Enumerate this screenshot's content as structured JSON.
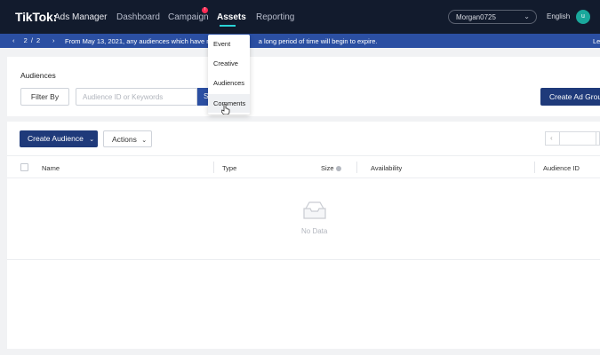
{
  "header": {
    "logo": "TikTok",
    "logo_suffix": ":",
    "product": "Ads Manager",
    "nav": [
      {
        "label": "Dashboard"
      },
      {
        "label": "Campaign"
      },
      {
        "label": "Assets"
      },
      {
        "label": "Reporting"
      }
    ],
    "campaign_badge": "!",
    "account": "Morgan0725",
    "language": "English",
    "avatar_initial": "u",
    "accent": "#2ad3d6"
  },
  "announcement": {
    "pager": "2 / 2",
    "message_left": "From May 13, 2021, any audiences which have not",
    "message_right": "a long period of time will begin to expire.",
    "learn": "Le"
  },
  "assets_menu": {
    "items": [
      {
        "label": "Event"
      },
      {
        "label": "Creative"
      },
      {
        "label": "Audiences"
      },
      {
        "label": "Comments"
      }
    ],
    "hovered": "Comments"
  },
  "filter_card": {
    "title": "Audiences",
    "filter_by": "Filter By",
    "search_placeholder": "Audience ID or Keywords",
    "search_button": "S",
    "create_ad_group": "Create Ad Group"
  },
  "toolbar": {
    "create_audience": "Create Audience",
    "actions": "Actions"
  },
  "table": {
    "columns": [
      "Name",
      "Type",
      "Size",
      "Availability",
      "Audience ID"
    ],
    "empty_text": "No Data"
  },
  "colors": {
    "nav_bg": "#121b2d",
    "announce_bg": "#2b4fa2",
    "primary_button": "#1f3a7a",
    "badge": "#fe2c55"
  }
}
